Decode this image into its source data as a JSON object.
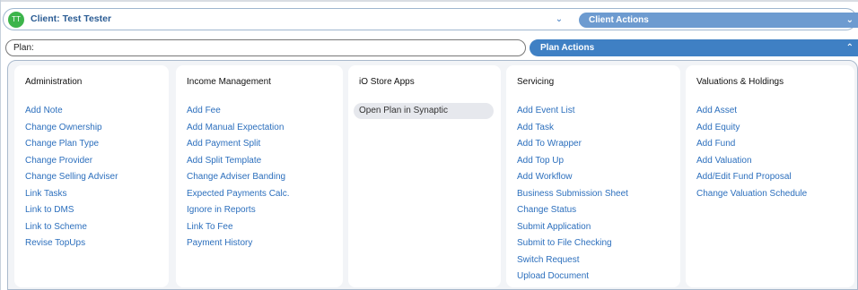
{
  "client": {
    "avatar_initials": "TT",
    "name": "Client: Test Tester",
    "toggle_icon": "chevron-down-icon",
    "actions_label": "Client Actions"
  },
  "plan": {
    "input_value": "Plan:",
    "actions_label": "Plan Actions",
    "actions_icon": "chevron-up-icon"
  },
  "colors": {
    "accent": "#3f80c4",
    "link": "#2c6fbd",
    "avatar": "#3cb44b"
  },
  "columns": [
    {
      "title": "Administration",
      "items": [
        "Add Note",
        "Change Ownership",
        "Change Plan Type",
        "Change Provider",
        "Change Selling Adviser",
        "Link Tasks",
        "Link to DMS",
        "Link to Scheme",
        "Revise TopUps"
      ]
    },
    {
      "title": "Income Management",
      "items": [
        "Add Fee",
        "Add Manual Expectation",
        "Add Payment Split",
        "Add Split Template",
        "Change Adviser Banding",
        "Expected Payments Calc.",
        "Ignore in Reports",
        "Link To Fee",
        "Payment History"
      ]
    },
    {
      "title": "iO Store Apps",
      "items": [
        "Open Plan in Synaptic"
      ]
    },
    {
      "title": "Servicing",
      "items": [
        "Add Event List",
        "Add Task",
        "Add To Wrapper",
        "Add Top Up",
        "Add Workflow",
        "Business Submission Sheet",
        "Change Status",
        "Submit Application",
        "Submit to File Checking",
        "Switch Request",
        "Upload Document"
      ]
    },
    {
      "title": "Valuations & Holdings",
      "items": [
        "Add Asset",
        "Add Equity",
        "Add Fund",
        "Add Valuation",
        "Add/Edit Fund Proposal",
        "Change Valuation Schedule"
      ]
    }
  ]
}
